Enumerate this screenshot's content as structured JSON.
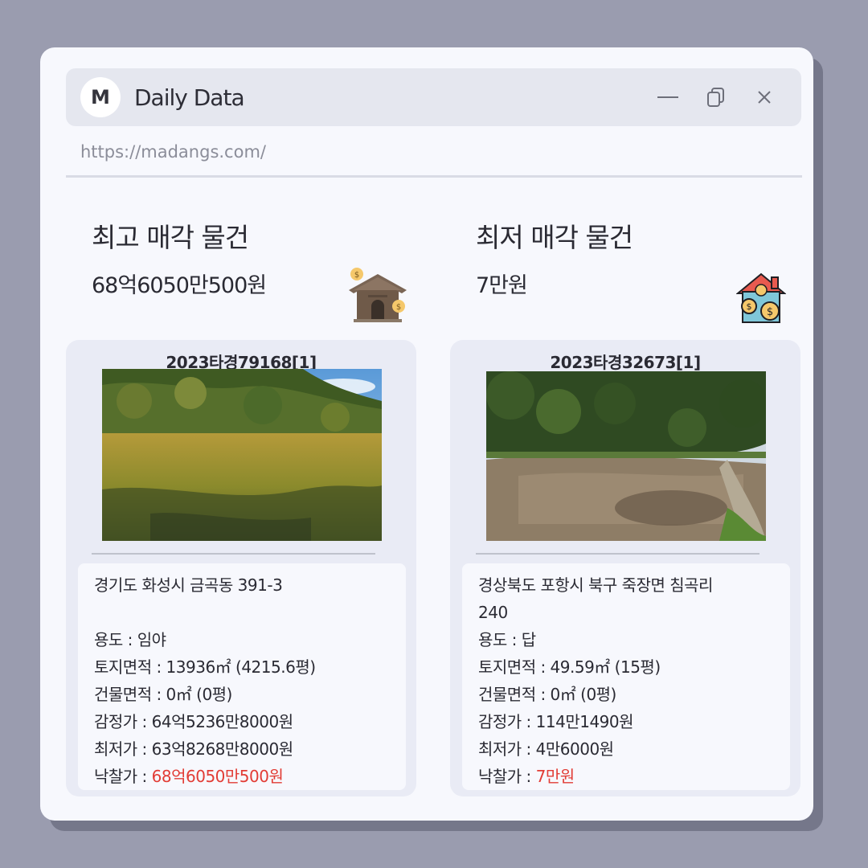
{
  "window": {
    "logo_letter": "M",
    "title": "Daily Data",
    "url": "https://madangs.com/",
    "controls": [
      "minimize-icon",
      "copy-icon",
      "close-icon"
    ]
  },
  "highest": {
    "heading": "최고 매각 물건",
    "amount": "68억6050만500원",
    "icon": "house-coins-icon",
    "case_no": "2023타경79168[1]",
    "address": "경기도 화성시 금곡동 391-3",
    "usage": "용도 : 임야",
    "land_area": "토지면적 : 13936㎡ (4215.6평)",
    "building_area": "건물면적 : 0㎡ (0평)",
    "appraisal": "감정가 : 64억5236만8000원",
    "minimum": "최저가 : 63억8268만8000원",
    "winning_label": "낙찰가 : ",
    "winning_value": "68억6050만500원"
  },
  "lowest": {
    "heading": "최저 매각 물건",
    "amount": "7만원",
    "icon": "house-money-icon",
    "case_no": "2023타경32673[1]",
    "address": "경상북도 포항시 북구 죽장면 침곡리 240",
    "usage": "용도 : 답",
    "land_area": "토지면적 : 49.59㎡ (15평)",
    "building_area": "건물면적 : 0㎡ (0평)",
    "appraisal": "감정가 : 114만1490원",
    "minimum": "최저가 : 4만6000원",
    "winning_label": "낙찰가 : ",
    "winning_value": "7만원"
  },
  "colors": {
    "background": "#9a9caf",
    "window": "#f7f8fd",
    "titlebar": "#e5e7ef",
    "card": "#e9ebf5",
    "accent_red": "#e23c35"
  }
}
